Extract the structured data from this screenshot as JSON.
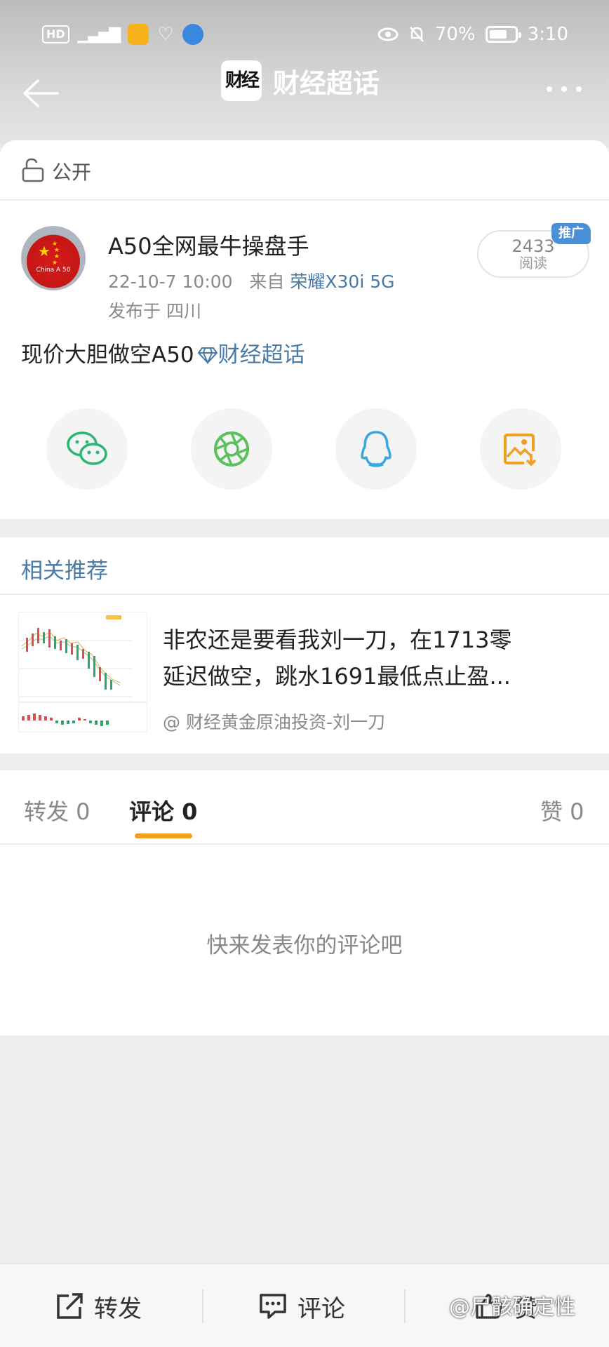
{
  "status_bar": {
    "hd": "HD",
    "signal": "5G",
    "eye_icon": "eye-icon",
    "battery_percent": "70%",
    "battery_level": 0.7,
    "time": "3:10"
  },
  "nav": {
    "title_logo": "财经",
    "title": "财经超话"
  },
  "visibility": {
    "label": "公开"
  },
  "post": {
    "author": "A50全网最牛操盘手",
    "avatar_text": "China A 50",
    "date": "22-10-7 10:00",
    "from_prefix": "来自",
    "device": "荣耀X30i 5G",
    "location": "发布于 四川",
    "read_count": "2433",
    "read_label": "阅读",
    "promo_badge": "推广",
    "text": "现价大胆做空A50",
    "topic": "财经超话"
  },
  "share": {
    "icons": [
      "wechat-icon",
      "moments-icon",
      "qq-icon",
      "save-image-icon"
    ],
    "colors": {
      "wechat": "#2bb673",
      "moments": "#5cc05c",
      "qq": "#3aa7e0",
      "save": "#f0a020"
    }
  },
  "related": {
    "title": "相关推荐",
    "item": {
      "line1": "非农还是要看我刘一刀，在1713零",
      "line2": "延迟做空，跳水1691最低点止盈...",
      "author": "@ 财经黄金原油投资-刘一刀"
    }
  },
  "tabs": {
    "repost": "转发 0",
    "comment": "评论 0",
    "like": "赞 0",
    "empty_hint": "快来发表你的评论吧"
  },
  "bottom_bar": {
    "repost": "转发",
    "comment": "评论",
    "like": "赞"
  },
  "watermark": "@尸骸确定性"
}
